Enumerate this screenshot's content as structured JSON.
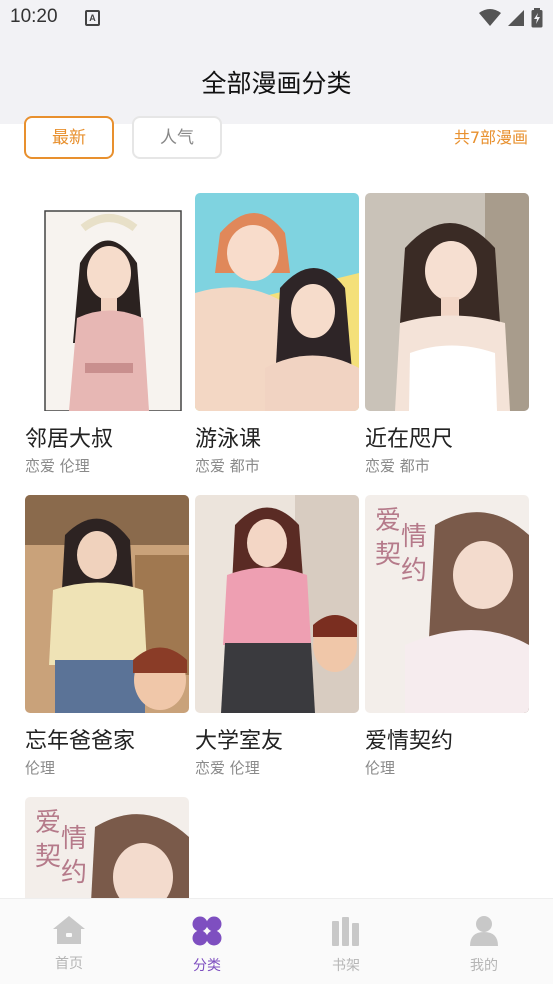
{
  "status_bar": {
    "time": "10:20",
    "badge": "A"
  },
  "header": {
    "title": "全部漫画分类"
  },
  "filters": {
    "tabs": [
      {
        "label": "最新",
        "active": true
      },
      {
        "label": "人气",
        "active": false
      }
    ],
    "total": "共7部漫画",
    "accent_color": "#e8902e"
  },
  "comics": [
    {
      "title": "邻居大叔",
      "tags": "恋爱 伦理"
    },
    {
      "title": "游泳课",
      "tags": "恋爱 都市"
    },
    {
      "title": "近在咫尺",
      "tags": "恋爱 都市"
    },
    {
      "title": "忘年爸爸家",
      "tags": "伦理"
    },
    {
      "title": "大学室友",
      "tags": "恋爱 伦理"
    },
    {
      "title": "爱情契约",
      "tags": "伦理",
      "cover_text": "爱 情 契 约"
    },
    {
      "title": "",
      "tags": "",
      "cover_text": "爱 情 契 约"
    }
  ],
  "bottom_nav": {
    "items": [
      {
        "label": "首页",
        "icon": "home-icon",
        "active": false
      },
      {
        "label": "分类",
        "icon": "category-icon",
        "active": true
      },
      {
        "label": "书架",
        "icon": "bookshelf-icon",
        "active": false
      },
      {
        "label": "我的",
        "icon": "profile-icon",
        "active": false
      }
    ],
    "active_color": "#7e4fc0",
    "inactive_color": "#b5b5b5"
  }
}
